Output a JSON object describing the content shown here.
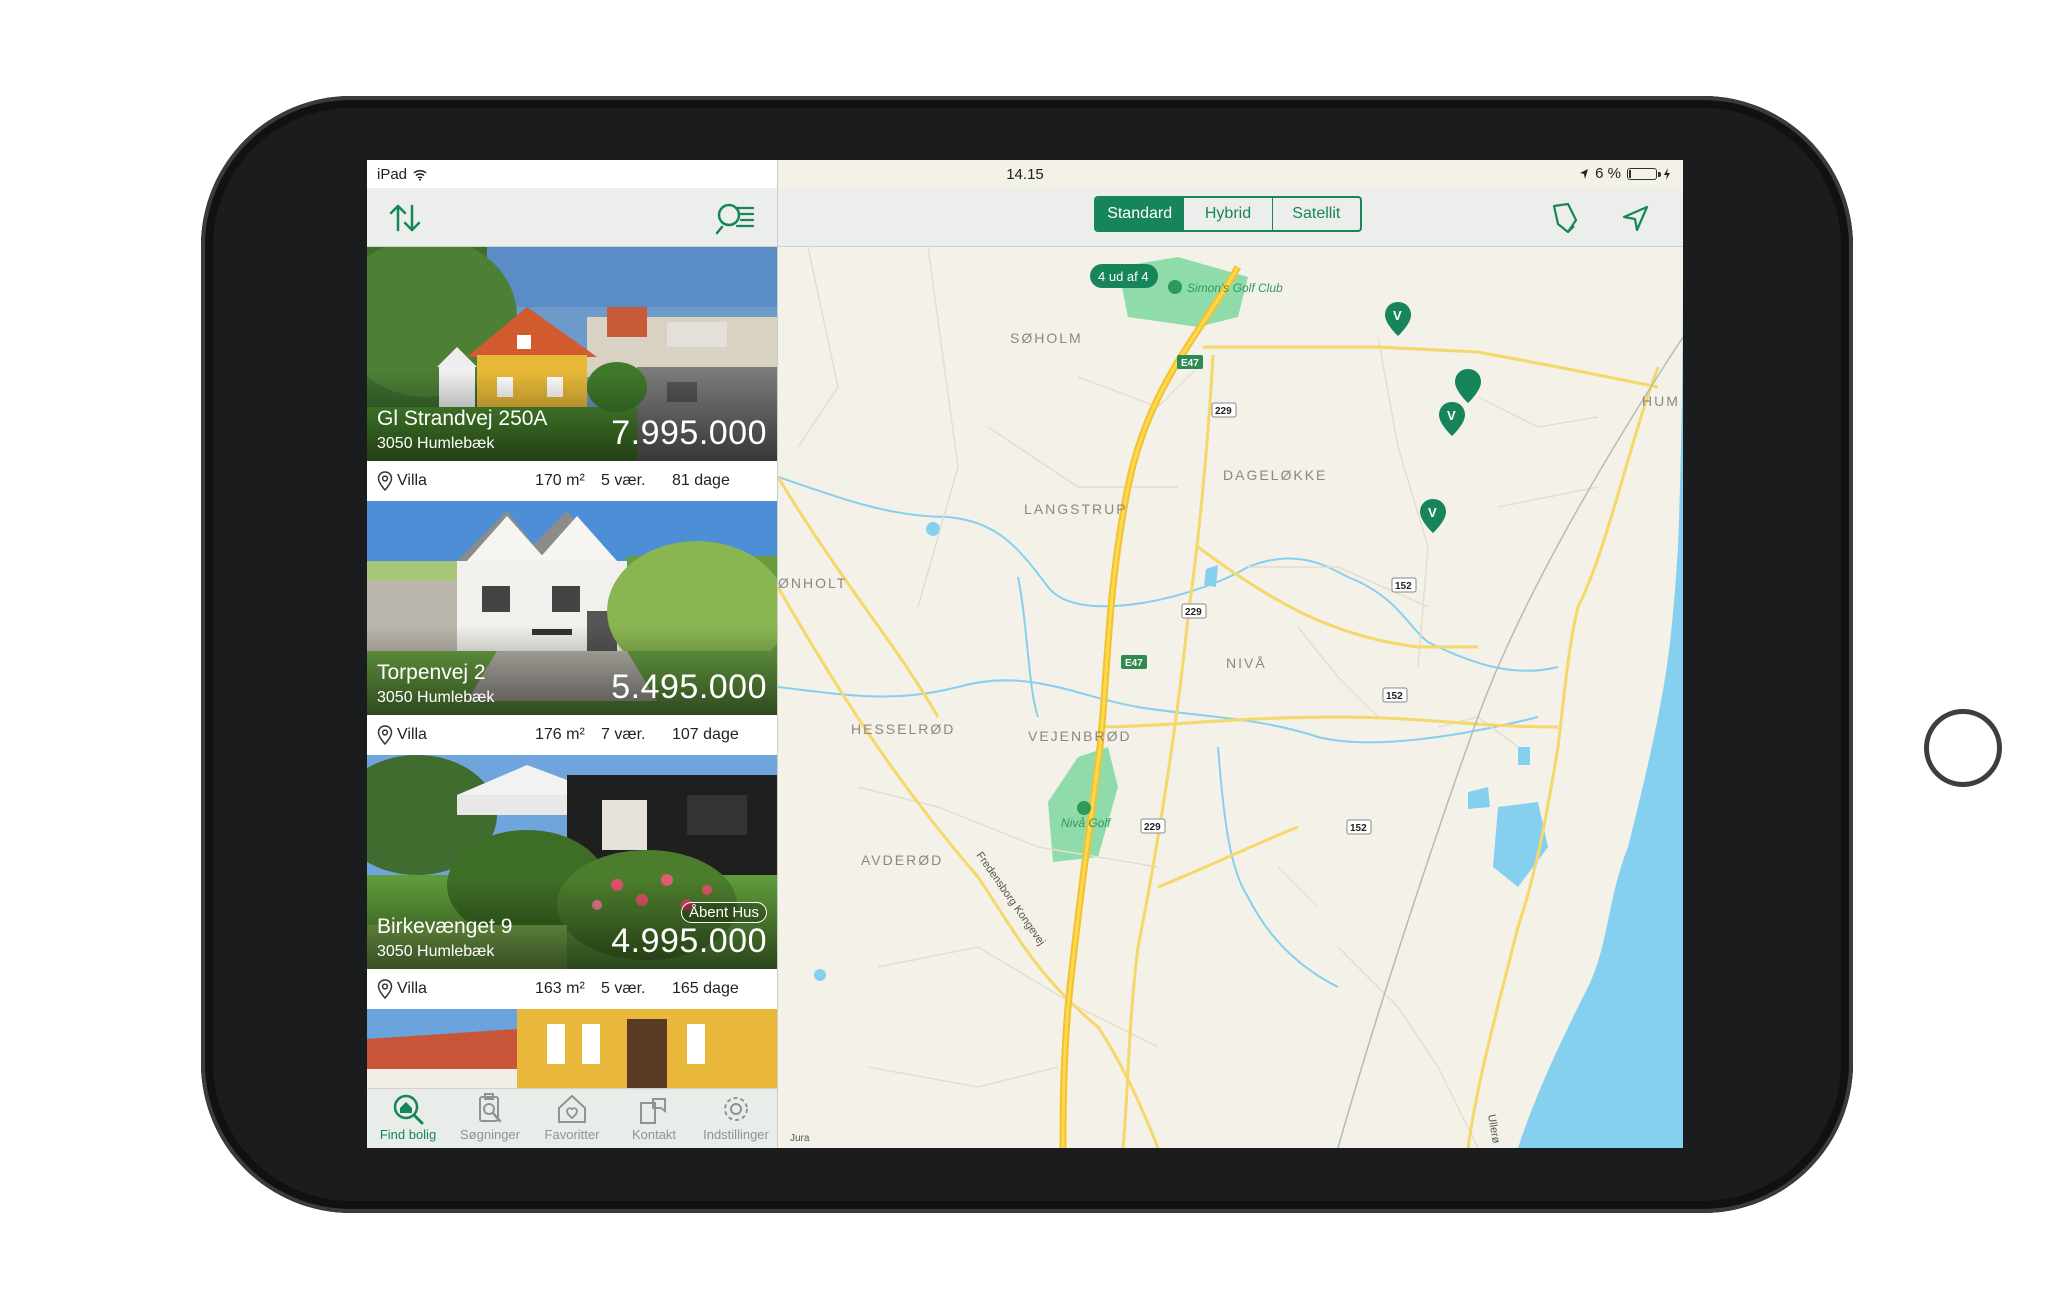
{
  "status": {
    "device": "iPad",
    "time": "14.15",
    "battery": "6 %",
    "battery_fraction": 0.06
  },
  "map": {
    "segments": [
      "Standard",
      "Hybrid",
      "Satellit"
    ],
    "selected_segment": "Standard",
    "results_badge": "4 ud af 4",
    "places": [
      "SØHOLM",
      "LANGSTRUP",
      "DAGELØKKE",
      "ØNHOLT",
      "NIVÅ",
      "HESSELRØD",
      "VEJENBRØD",
      "AVDERØD",
      "HUM"
    ],
    "golf": [
      "Simon's Golf Club",
      "Nivå Golf"
    ],
    "roads": {
      "e47": "E47",
      "r229": "229",
      "r152": "152",
      "street": "Fredensborg Kongevej",
      "street2": "Ullerø"
    },
    "attribution": "Jura",
    "pin_label": "V",
    "colors": {
      "water": "#86d0ef",
      "park": "#8fdcaa",
      "highway": "#f1c232",
      "road": "#f5d86a",
      "land": "#f4f1e9"
    }
  },
  "listings": [
    {
      "address": "Gl Strandvej 250A",
      "city": "3050 Humlebæk",
      "price": "7.995.000",
      "type": "Villa",
      "area": "170 m²",
      "rooms": "5 vær.",
      "days": "81 dage",
      "badge": ""
    },
    {
      "address": "Torpenvej 2",
      "city": "3050 Humlebæk",
      "price": "5.495.000",
      "type": "Villa",
      "area": "176 m²",
      "rooms": "7 vær.",
      "days": "107 dage",
      "badge": ""
    },
    {
      "address": "Birkevænget 9",
      "city": "3050 Humlebæk",
      "price": "4.995.000",
      "type": "Villa",
      "area": "163 m²",
      "rooms": "5 vær.",
      "days": "165 dage",
      "badge": "Åbent Hus"
    }
  ],
  "tabs": [
    "Find bolig",
    "Søgninger",
    "Favoritter",
    "Kontakt",
    "Indstillinger"
  ],
  "accent_color": "#16855a",
  "icons": [
    "sort-icon",
    "search-filter-icon",
    "draw-area-icon",
    "location-arrow-icon",
    "wifi-icon",
    "location-icon",
    "battery-icon",
    "pin-icon",
    "home-search-icon",
    "search-doc-icon",
    "heart-house-icon",
    "contact-icon",
    "settings-gear-icon"
  ]
}
